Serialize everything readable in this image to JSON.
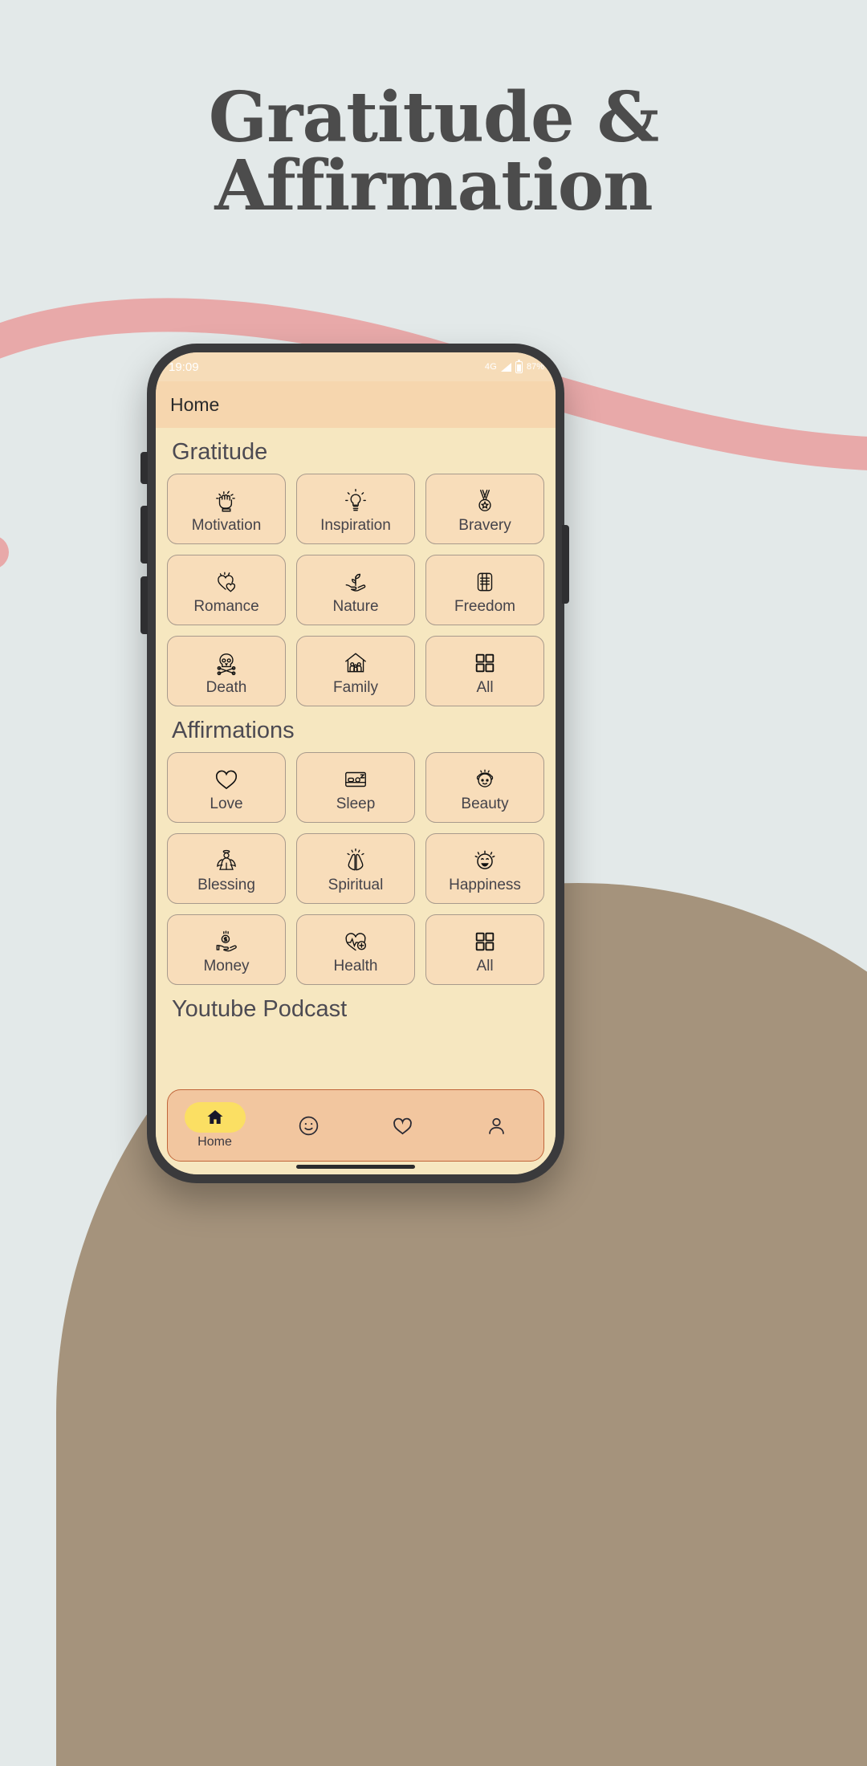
{
  "poster": {
    "headline_line1": "Gratitude &",
    "headline_line2": "Affirmation",
    "bg_color": "#e3e9e9",
    "swoosh_color": "#e8a9a9",
    "blob_color": "#a5937c",
    "headline_color": "#4c4c4c"
  },
  "phone": {
    "status_bar": {
      "time": "19:09",
      "network": "4G",
      "battery_percent": "87%",
      "signal_icon": "signal-bars-icon",
      "battery_icon": "battery-icon"
    },
    "app_bar": {
      "title": "Home"
    },
    "sections": [
      {
        "title": "Gratitude",
        "tiles": [
          {
            "label": "Motivation",
            "icon": "raised-fist-icon"
          },
          {
            "label": "Inspiration",
            "icon": "lightbulb-icon"
          },
          {
            "label": "Bravery",
            "icon": "medal-icon"
          },
          {
            "label": "Romance",
            "icon": "two-hearts-icon"
          },
          {
            "label": "Nature",
            "icon": "hand-sprout-icon"
          },
          {
            "label": "Freedom",
            "icon": "fist-icon"
          },
          {
            "label": "Death",
            "icon": "skull-crossbones-icon"
          },
          {
            "label": "Family",
            "icon": "family-house-icon"
          },
          {
            "label": "All",
            "icon": "grid-squares-icon"
          }
        ]
      },
      {
        "title": "Affirmations",
        "tiles": [
          {
            "label": "Love",
            "icon": "heart-icon"
          },
          {
            "label": "Sleep",
            "icon": "sleeping-bed-icon"
          },
          {
            "label": "Beauty",
            "icon": "face-spa-icon"
          },
          {
            "label": "Blessing",
            "icon": "angel-icon"
          },
          {
            "label": "Spiritual",
            "icon": "praying-hands-icon"
          },
          {
            "label": "Happiness",
            "icon": "smiling-face-icon"
          },
          {
            "label": "Money",
            "icon": "hand-coin-icon"
          },
          {
            "label": "Health",
            "icon": "heart-pulse-plus-icon"
          },
          {
            "label": "All",
            "icon": "grid-squares-icon"
          }
        ]
      },
      {
        "title": "Youtube Podcast",
        "tiles": []
      }
    ],
    "bottom_nav": [
      {
        "label": "Home",
        "icon": "home-icon",
        "active": true
      },
      {
        "label": "",
        "icon": "smiley-icon",
        "active": false
      },
      {
        "label": "",
        "icon": "heart-outline-icon",
        "active": false
      },
      {
        "label": "",
        "icon": "person-icon",
        "active": false
      }
    ],
    "colors": {
      "screen_bg": "#f6e7c0",
      "appbar_bg": "#f6d6ae",
      "tile_bg": "#f8ddba",
      "tile_border": "#a89a8c",
      "nav_bg": "#f2c69f",
      "nav_border": "#c0653a",
      "nav_pill": "#fbdf63"
    }
  }
}
